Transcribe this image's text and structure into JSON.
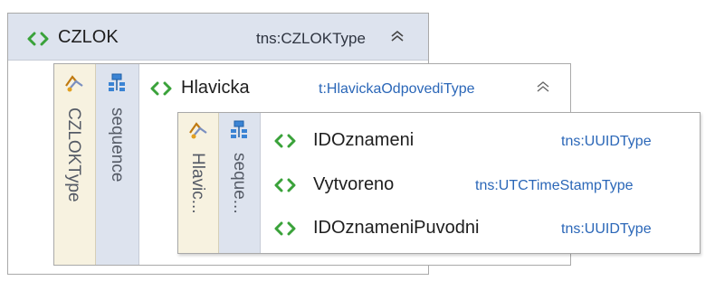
{
  "outer": {
    "name": "CZLOK",
    "type": "tns:CZLOKType",
    "collapse_symbol": "∧",
    "type_strip_label": "CZLOKType",
    "sequence_label": "sequence"
  },
  "middle": {
    "name": "Hlavicka",
    "type": "t:HlavickaOdpovediType",
    "collapse_symbol": "∧",
    "type_strip_label": "Hlavic...",
    "sequence_label": "seque..."
  },
  "elements": [
    {
      "name": "IDOznameni",
      "type": "tns:UUIDType"
    },
    {
      "name": "Vytvoreno",
      "type": "tns:UTCTimeStampType"
    },
    {
      "name": "IDOznameniPuvodni",
      "type": "tns:UUIDType"
    }
  ],
  "colors": {
    "element_icon": "#3aa23a",
    "type_text": "#2b67b8",
    "header_bg": "#dde3ee",
    "type_strip_bg": "#f7f2e0"
  },
  "icons": {
    "element": "element-tag-icon",
    "complex_type": "complex-type-icon",
    "sequence": "sequence-icon",
    "collapse": "collapse-chevron-icon"
  }
}
